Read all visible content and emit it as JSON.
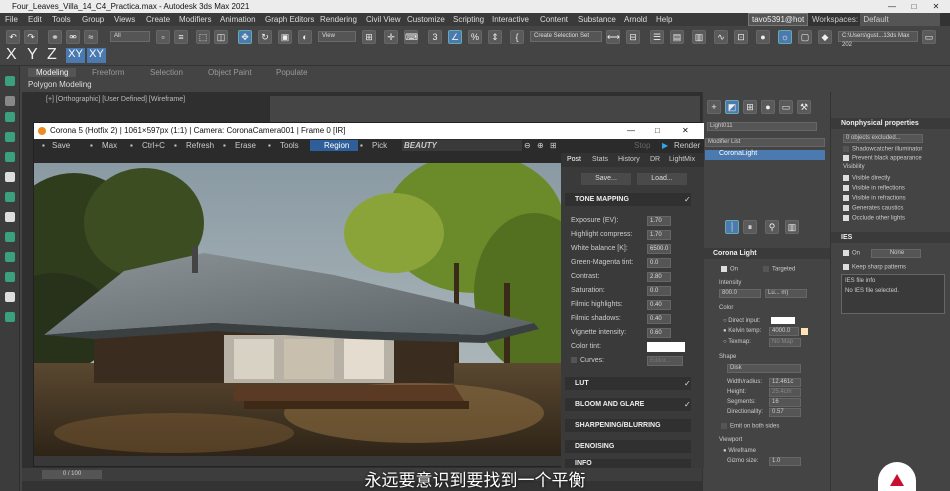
{
  "window": {
    "title": "Four_Leaves_Villa_14_C4_Practica.max - Autodesk 3ds Max 2021",
    "min": "—",
    "max": "□",
    "close": "✕"
  },
  "menu": [
    "File",
    "Edit",
    "Tools",
    "Group",
    "Views",
    "Create",
    "Modifiers",
    "Animation",
    "Graph Editors",
    "Rendering",
    "Civil View",
    "Customize",
    "Scripting",
    "Interactive",
    "Content",
    "Substance",
    "Arnold",
    "Help"
  ],
  "user": "tavo5391@hot",
  "workspace": {
    "label": "Workspaces:",
    "value": "Default"
  },
  "toolbar": {
    "filter": "All",
    "view": "View",
    "selection_set": "Create Selection Set",
    "path": "C:\\Users\\gust...13ds Max 202",
    "axes": [
      "X",
      "Y",
      "Z",
      "XY",
      "XY"
    ]
  },
  "ribbon_tabs": [
    "Modeling",
    "Freeform",
    "Selection",
    "Object Paint",
    "Populate"
  ],
  "polygon_modeling": "Polygon Modeling",
  "viewport_label": "[+] [Orthographic] [User Defined] [Wireframe]",
  "vfb": {
    "title": "Corona 5 (Hotfix 2) | 1061×597px (1:1) | Camera: CoronaCamera001 | Frame 0 [IR]",
    "tools": [
      "Save",
      "Max",
      "Ctrl+C",
      "Refresh",
      "Erase",
      "Tools",
      "Region",
      "Pick"
    ],
    "beauty": "BEAUTY",
    "stop": "Stop",
    "render": "Render",
    "side_tabs": [
      "Post",
      "Stats",
      "History",
      "DR",
      "LightMix"
    ],
    "save_btn": "Save...",
    "load_btn": "Load...",
    "tone_mapping": "TONE MAPPING",
    "rows": [
      {
        "label": "Exposure (EV):",
        "value": "1.70"
      },
      {
        "label": "Highlight compress:",
        "value": "1.70"
      },
      {
        "label": "White balance [K]:",
        "value": "6500.0"
      },
      {
        "label": "Green-Magenta tint:",
        "value": "0.0"
      },
      {
        "label": "Contrast:",
        "value": "2.80"
      },
      {
        "label": "Saturation:",
        "value": "0.0"
      },
      {
        "label": "Filmic highlights:",
        "value": "0.40"
      },
      {
        "label": "Filmic shadows:",
        "value": "0.40"
      },
      {
        "label": "Vignette intensity:",
        "value": "0.60"
      }
    ],
    "color_tint": "Color tint:",
    "curves": "Curves:",
    "curves_btn": "Editor...",
    "sections": [
      "LUT",
      "BLOOM AND GLARE",
      "SHARPENING/BLURRING",
      "DENOISING",
      "INFO"
    ]
  },
  "command_panel": {
    "name": "Light011",
    "modifier_list": "Modifier List",
    "stack_item": "CoronaLight",
    "rollout": "Corona Light",
    "on": "On",
    "targeted": "Targeted",
    "intensity_label": "Intensity",
    "intensity_value": "800.0",
    "intensity_unit": "Lu... m)",
    "color_label": "Color",
    "direct_input": "Direct input:",
    "kelvin_temp": "Kelvin temp:",
    "kelvin_value": "4000.0",
    "texmap": "Texmap:",
    "texmap_btn": "No Map",
    "shape_label": "Shape",
    "shape_value": "Disk",
    "width_radius": "Width/radius:",
    "width_value": "12.461c",
    "height": "Height:",
    "height_value": "25.4cm",
    "segments": "Segments:",
    "segments_value": "16",
    "directionality": "Directionality:",
    "directionality_value": "0.57",
    "emit_both": "Emit on both sides",
    "viewport_label": "Viewport",
    "wireframe": "Wireframe",
    "gizmo_size": "Gizmo size:",
    "gizmo_value": "1.0"
  },
  "right_panel": {
    "nonphysical": "Nonphysical properties",
    "excluded": "0 objects excluded...",
    "shadowcatcher": "Shadowcatcher illuminator",
    "prevent_black": "Prevent black appearance",
    "visibility": "Visibility",
    "vis_items": [
      "Visible directly",
      "Visible in reflections",
      "Visible in refractions",
      "Generates caustics",
      "Occlude other lights"
    ],
    "ies": "IES",
    "ies_on": "On",
    "ies_btn": "None",
    "keep_sharp": "Keep sharp patterns",
    "ies_info": "IES file info",
    "no_ies": "No IES file selected."
  },
  "status": {
    "frames": "0 / 100"
  },
  "subtitle": "永远要意识到要找到一个平衡"
}
